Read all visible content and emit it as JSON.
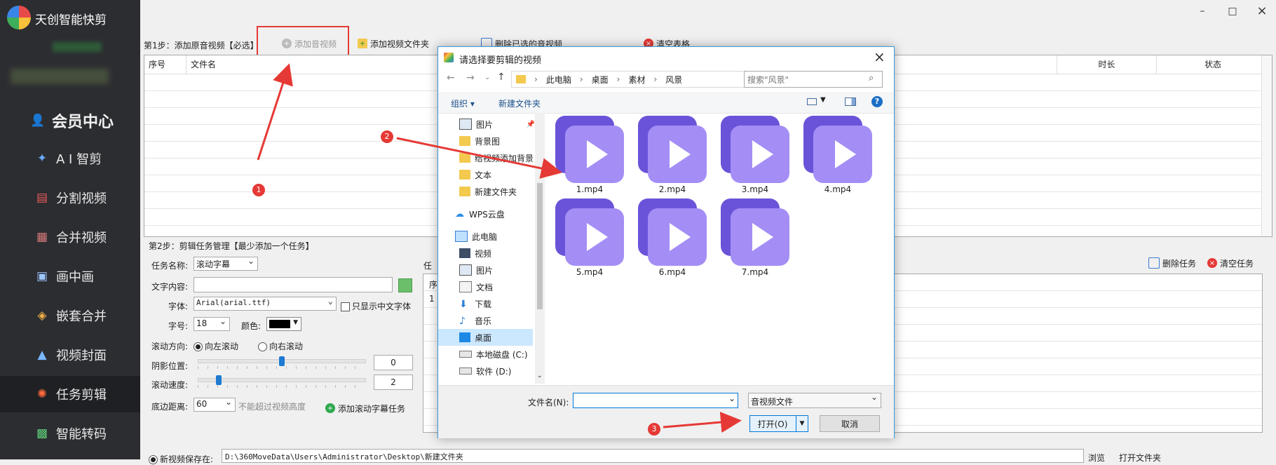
{
  "app": {
    "title": "天创智能快剪"
  },
  "window": {
    "minimize": "–",
    "maximize": "□",
    "close": "×"
  },
  "sidebar": {
    "vip_label": "会员中心",
    "items": [
      {
        "label": "A I 智剪",
        "icon": "magic-wand-icon"
      },
      {
        "label": "分割视频",
        "icon": "split-icon"
      },
      {
        "label": "合并视频",
        "icon": "merge-icon"
      },
      {
        "label": "画中画",
        "icon": "picture-in-picture-icon"
      },
      {
        "label": "嵌套合并",
        "icon": "nest-icon"
      },
      {
        "label": "视频封面",
        "icon": "cover-icon"
      },
      {
        "label": "任务剪辑",
        "icon": "task-icon",
        "active": true
      },
      {
        "label": "智能转码",
        "icon": "transcode-icon"
      }
    ]
  },
  "step1": {
    "label": "第1步：添加原音视频【必选】",
    "add_audio_video": "添加音视频",
    "add_video_folder": "添加视频文件夹",
    "delete_selected": "删除已选的音视频",
    "clear_table": "清空表格",
    "columns": [
      "序号",
      "文件名",
      "时长",
      "状态"
    ]
  },
  "step2": {
    "label": "第2步：剪辑任务管理【最少添加一个任务】",
    "task_name_label": "任务名称:",
    "task_name_value": "滚动字幕",
    "text_content_label": "文字内容:",
    "text_content_value": "",
    "font_label": "字体:",
    "font_value": "Arial(arial.ttf)",
    "only_chinese_label": "只显示中文字体",
    "size_label": "字号:",
    "size_value": "18",
    "color_label": "颜色:",
    "direction_label": "滚动方向:",
    "dir_left": "向左滚动",
    "dir_right": "向右滚动",
    "shadow_label": "阴影位置:",
    "shadow_value": "0",
    "speed_label": "滚动速度:",
    "speed_value": "2",
    "bottom_label": "底边距离:",
    "bottom_value": "60",
    "bottom_hint": "不能超过视频高度",
    "add_task_button": "添加滚动字幕任务",
    "task_list_label": "任",
    "task_col_index": "序",
    "task_row_index": "1",
    "delete_task": "删除任务",
    "clear_tasks": "清空任务"
  },
  "save": {
    "label": "新视频保存在:",
    "path": "D:\\360MoveData\\Users\\Administrator\\Desktop\\新建文件夹",
    "browse": "浏览",
    "open_folder": "打开文件夹"
  },
  "dialog": {
    "title": "请选择要剪辑的视频",
    "close": "×",
    "breadcrumb": [
      "此电脑",
      "桌面",
      "素材",
      "风景"
    ],
    "search_placeholder": "搜索\"风景\"",
    "organize": "组织 ▾",
    "new_folder": "新建文件夹",
    "help": "?",
    "tree": [
      {
        "label": "图片",
        "icon": "pictures-icon"
      },
      {
        "label": "背景图",
        "icon": "folder-icon"
      },
      {
        "label": "给视频添加背景",
        "icon": "folder-icon"
      },
      {
        "label": "文本",
        "icon": "folder-icon"
      },
      {
        "label": "新建文件夹",
        "icon": "folder-icon"
      },
      {
        "label": "WPS云盘",
        "icon": "cloud-icon"
      },
      {
        "label": "此电脑",
        "icon": "computer-icon"
      },
      {
        "label": "视频",
        "icon": "videos-icon"
      },
      {
        "label": "图片",
        "icon": "pictures-icon"
      },
      {
        "label": "文档",
        "icon": "documents-icon"
      },
      {
        "label": "下载",
        "icon": "download-icon"
      },
      {
        "label": "音乐",
        "icon": "music-icon"
      },
      {
        "label": "桌面",
        "icon": "desktop-icon",
        "selected": true
      },
      {
        "label": "本地磁盘 (C:)",
        "icon": "drive-icon"
      },
      {
        "label": "软件 (D:)",
        "icon": "drive-icon"
      }
    ],
    "files": [
      "1.mp4",
      "2.mp4",
      "3.mp4",
      "4.mp4",
      "5.mp4",
      "6.mp4",
      "7.mp4"
    ],
    "filename_label": "文件名(N):",
    "filename_value": "",
    "filetype_value": "音视频文件",
    "open_button": "打开(O)",
    "cancel_button": "取消"
  },
  "annotations": {
    "step_one": "1",
    "step_two": "2",
    "step_three": "3"
  },
  "colors": {
    "annotation": "#e53935",
    "sidebar": "#2c2d31",
    "file_icon": "#a48ef5"
  }
}
